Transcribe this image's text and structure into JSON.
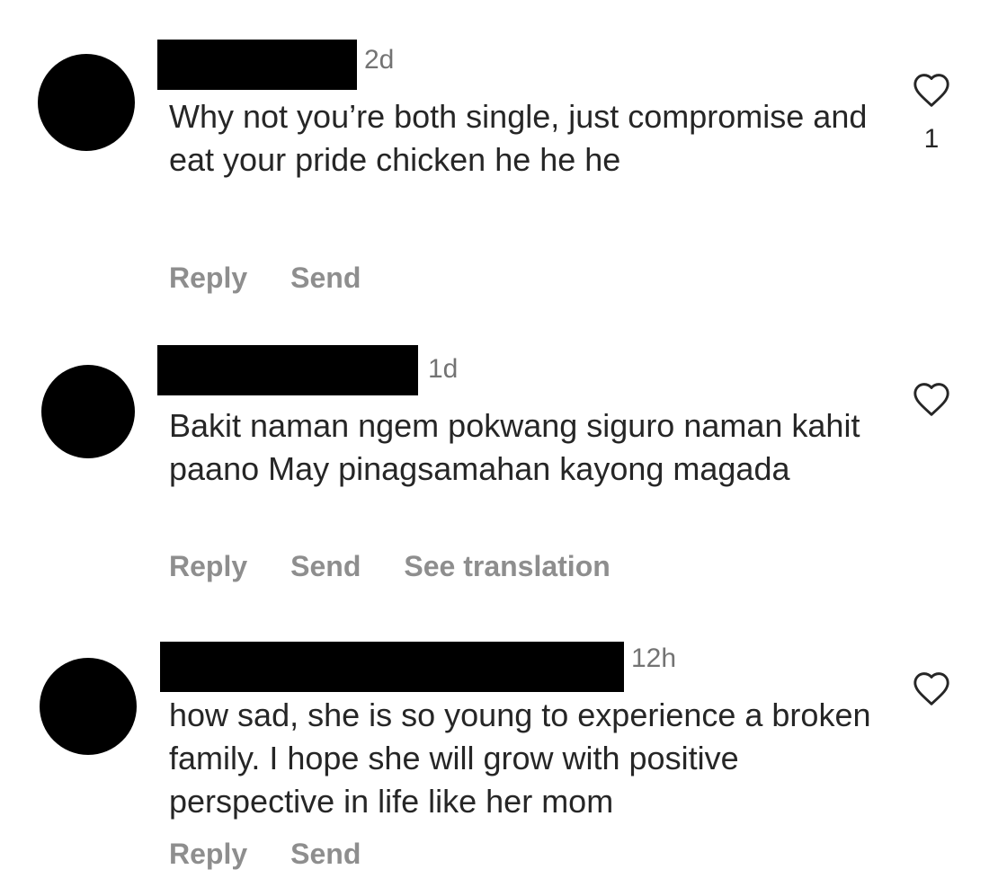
{
  "comments": [
    {
      "time": "2d",
      "text": "Why not you’re both single, just compromise and eat your pride chicken he he he",
      "actions": {
        "reply": "Reply",
        "send": "Send"
      },
      "like_count": "1"
    },
    {
      "time": "1d",
      "text": "Bakit naman ngem pokwang  siguro naman kahit paano May pinagsamahan kayong magada",
      "actions": {
        "reply": "Reply",
        "send": "Send",
        "translate": "See translation"
      }
    },
    {
      "time": "12h",
      "text": "how sad, she is so young to experience a broken family. I hope she will grow with positive perspective in life like her mom",
      "actions": {
        "reply": "Reply",
        "send": "Send"
      }
    }
  ],
  "icons": {
    "like": "heart-outline-icon",
    "avatar": "avatar-redacted"
  },
  "colors": {
    "text": "#262626",
    "muted": "#8e8e8e",
    "redaction": "#000000"
  }
}
